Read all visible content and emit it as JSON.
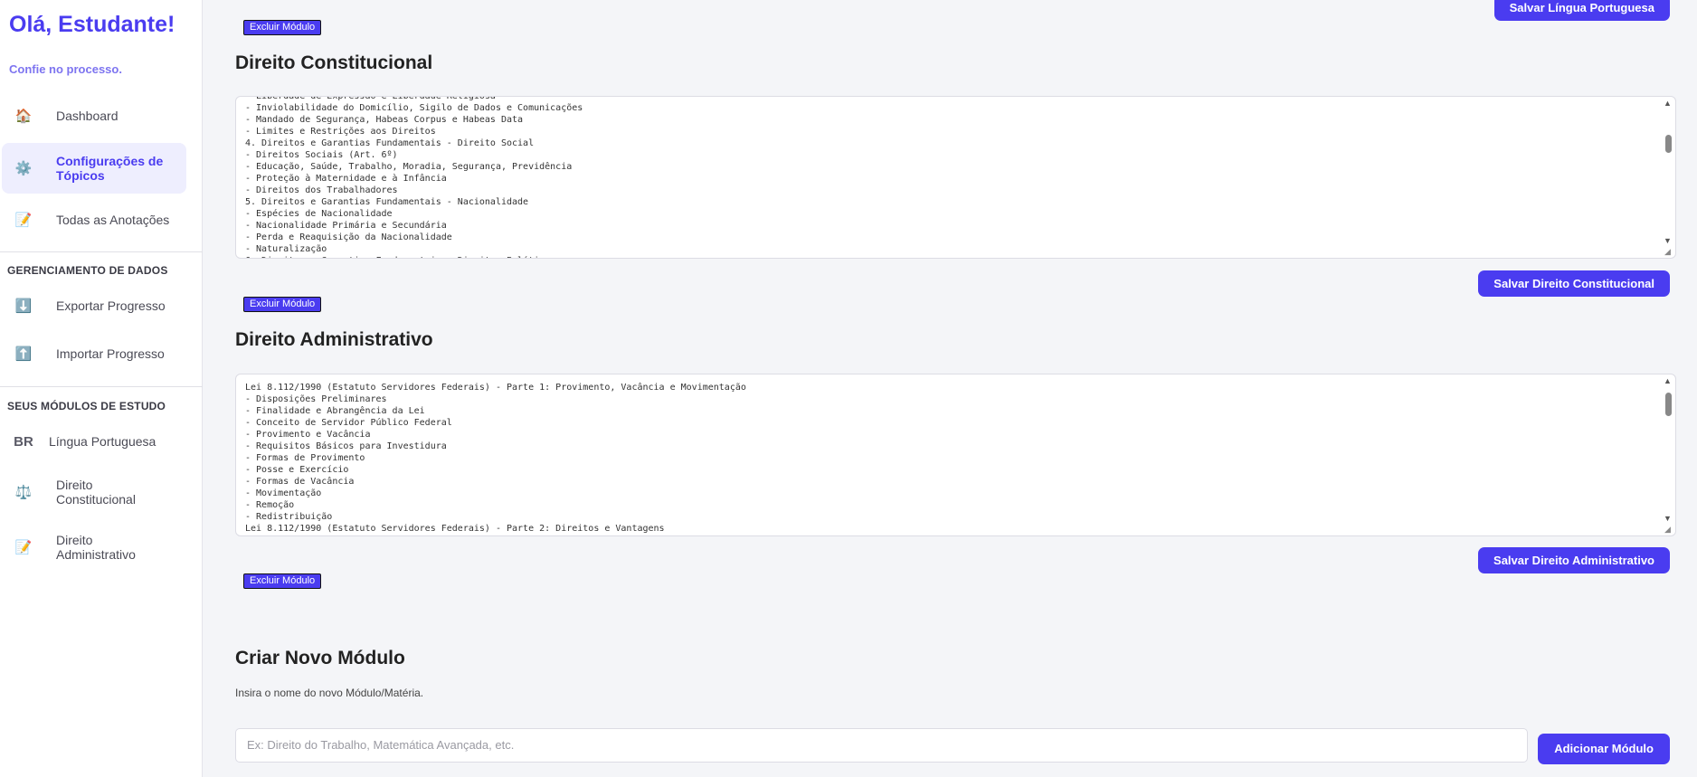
{
  "sidebar": {
    "greeting": "Olá, Estudante!",
    "tagline": "Confie no processo.",
    "nav": [
      {
        "label": "Dashboard",
        "icon": "🏠"
      },
      {
        "label": "Configurações de Tópicos",
        "icon": "⚙️"
      },
      {
        "label": "Todas as Anotações",
        "icon": "📝"
      }
    ],
    "data_section_title": "GERENCIAMENTO DE DADOS",
    "data_items": [
      {
        "label": "Exportar Progresso",
        "icon": "⬇️"
      },
      {
        "label": "Importar Progresso",
        "icon": "⬆️"
      }
    ],
    "modules_section_title": "SEUS MÓDULOS DE ESTUDO",
    "modules": [
      {
        "label": "Língua Portuguesa",
        "icon": "BR"
      },
      {
        "label": "Direito Constitucional",
        "icon": "⚖️"
      },
      {
        "label": "Direito Administrativo",
        "icon": "📝"
      }
    ]
  },
  "main": {
    "top_save_label": "Salvar Língua Portuguesa",
    "delete_label": "Excluir Módulo",
    "modules": [
      {
        "title": "Direito Constitucional",
        "content": "- Liberdade de Expressão e Liberdade Religiosa\n- Inviolabilidade do Domicílio, Sigilo de Dados e Comunicações\n- Mandado de Segurança, Habeas Corpus e Habeas Data\n- Limites e Restrições aos Direitos\n4. Direitos e Garantias Fundamentais - Direito Social\n- Direitos Sociais (Art. 6º)\n- Educação, Saúde, Trabalho, Moradia, Segurança, Previdência\n- Proteção à Maternidade e à Infância\n- Direitos dos Trabalhadores\n5. Direitos e Garantias Fundamentais - Nacionalidade\n- Espécies de Nacionalidade\n- Nacionalidade Primária e Secundária\n- Perda e Reaquisição da Nacionalidade\n- Naturalização\n6. Direitos e Garantias Fundamentais - Direitos Políticos",
        "save_label": "Salvar Direito Constitucional"
      },
      {
        "title": "Direito Administrativo",
        "content": "Lei 8.112/1990 (Estatuto Servidores Federais) - Parte 1: Provimento, Vacância e Movimentação\n- Disposições Preliminares\n- Finalidade e Abrangência da Lei\n- Conceito de Servidor Público Federal\n- Provimento e Vacância\n- Requisitos Básicos para Investidura\n- Formas de Provimento\n- Posse e Exercício\n- Formas de Vacância\n- Movimentação\n- Remoção\n- Redistribuição\nLei 8.112/1990 (Estatuto Servidores Federais) - Parte 2: Direitos e Vantagens",
        "save_label": "Salvar Direito Administrativo"
      }
    ],
    "create": {
      "title": "Criar Novo Módulo",
      "description": "Insira o nome do novo Módulo/Matéria.",
      "placeholder": "Ex: Direito do Trabalho, Matemática Avançada, etc.",
      "button_label": "Adicionar Módulo"
    }
  }
}
